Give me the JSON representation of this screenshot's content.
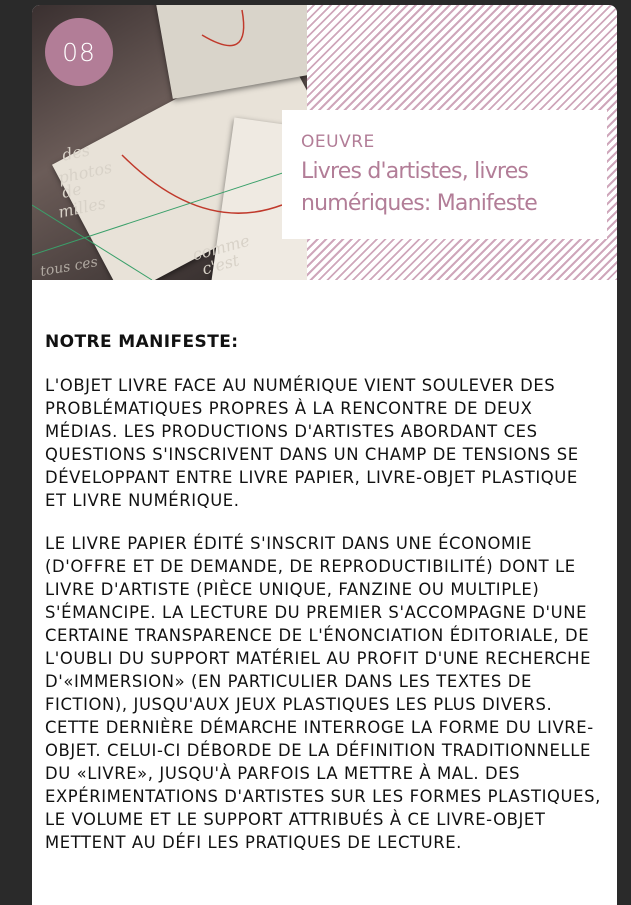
{
  "card": {
    "number": "08",
    "kicker": "OEUVRE",
    "title": "Livres d'artistes, livres numériques: Manifeste"
  },
  "image": {
    "words": [
      "des",
      "photos",
      "de",
      "milles",
      "comme",
      "c'est",
      "tous ces"
    ],
    "alt_icon": "book-photo"
  },
  "article": {
    "heading": "NOTRE MANIFESTE:",
    "paragraphs": [
      "L'OBJET LIVRE FACE AU NUMÉRIQUE VIENT SOULEVER DES PROBLÉMATIQUES PROPRES À LA RENCONTRE DE DEUX MÉDIAS. LES PRODUCTIONS D'ARTISTES ABORDANT CES QUESTIONS S'INSCRIVENT DANS UN CHAMP DE TENSIONS SE DÉVELOPPANT ENTRE LIVRE PAPIER, LIVRE-OBJET PLASTIQUE ET LIVRE NUMÉRIQUE.",
      "LE LIVRE PAPIER ÉDITÉ S'INSCRIT DANS UNE ÉCONOMIE (D'OFFRE ET DE DEMANDE, DE REPRODUCTIBILITÉ) DONT LE LIVRE D'ARTISTE (PIÈCE UNIQUE, FANZINE OU MULTIPLE) S'ÉMANCIPE. LA LECTURE DU PREMIER S'ACCOMPAGNE D'UNE CERTAINE TRANSPARENCE DE L'ÉNONCIATION ÉDITORIALE, DE L'OUBLI DU SUPPORT MATÉRIEL AU PROFIT D'UNE RECHERCHE D'«IMMERSION» (EN PARTICULIER DANS LES TEXTES DE FICTION), JUSQU'AUX JEUX PLASTIQUES LES PLUS DIVERS. CETTE DERNIÈRE DÉMARCHE INTERROGE LA FORME DU LIVRE-OBJET. CELUI-CI DÉBORDE DE LA DÉFINITION TRADITIONNELLE DU «LIVRE», JUSQU'À PARFOIS LA METTRE À MAL. DES EXPÉRIMENTATIONS D'ARTISTES SUR LES FORMES PLASTIQUES, LE VOLUME ET LE SUPPORT ATTRIBUÉS À CE LIVRE-OBJET METTENT AU DÉFI LES PRATIQUES DE LECTURE."
    ]
  },
  "colors": {
    "accent": "#b27d97",
    "stripe": "#cfa7bb",
    "background": "#2a2a2a",
    "card": "#ffffff"
  }
}
